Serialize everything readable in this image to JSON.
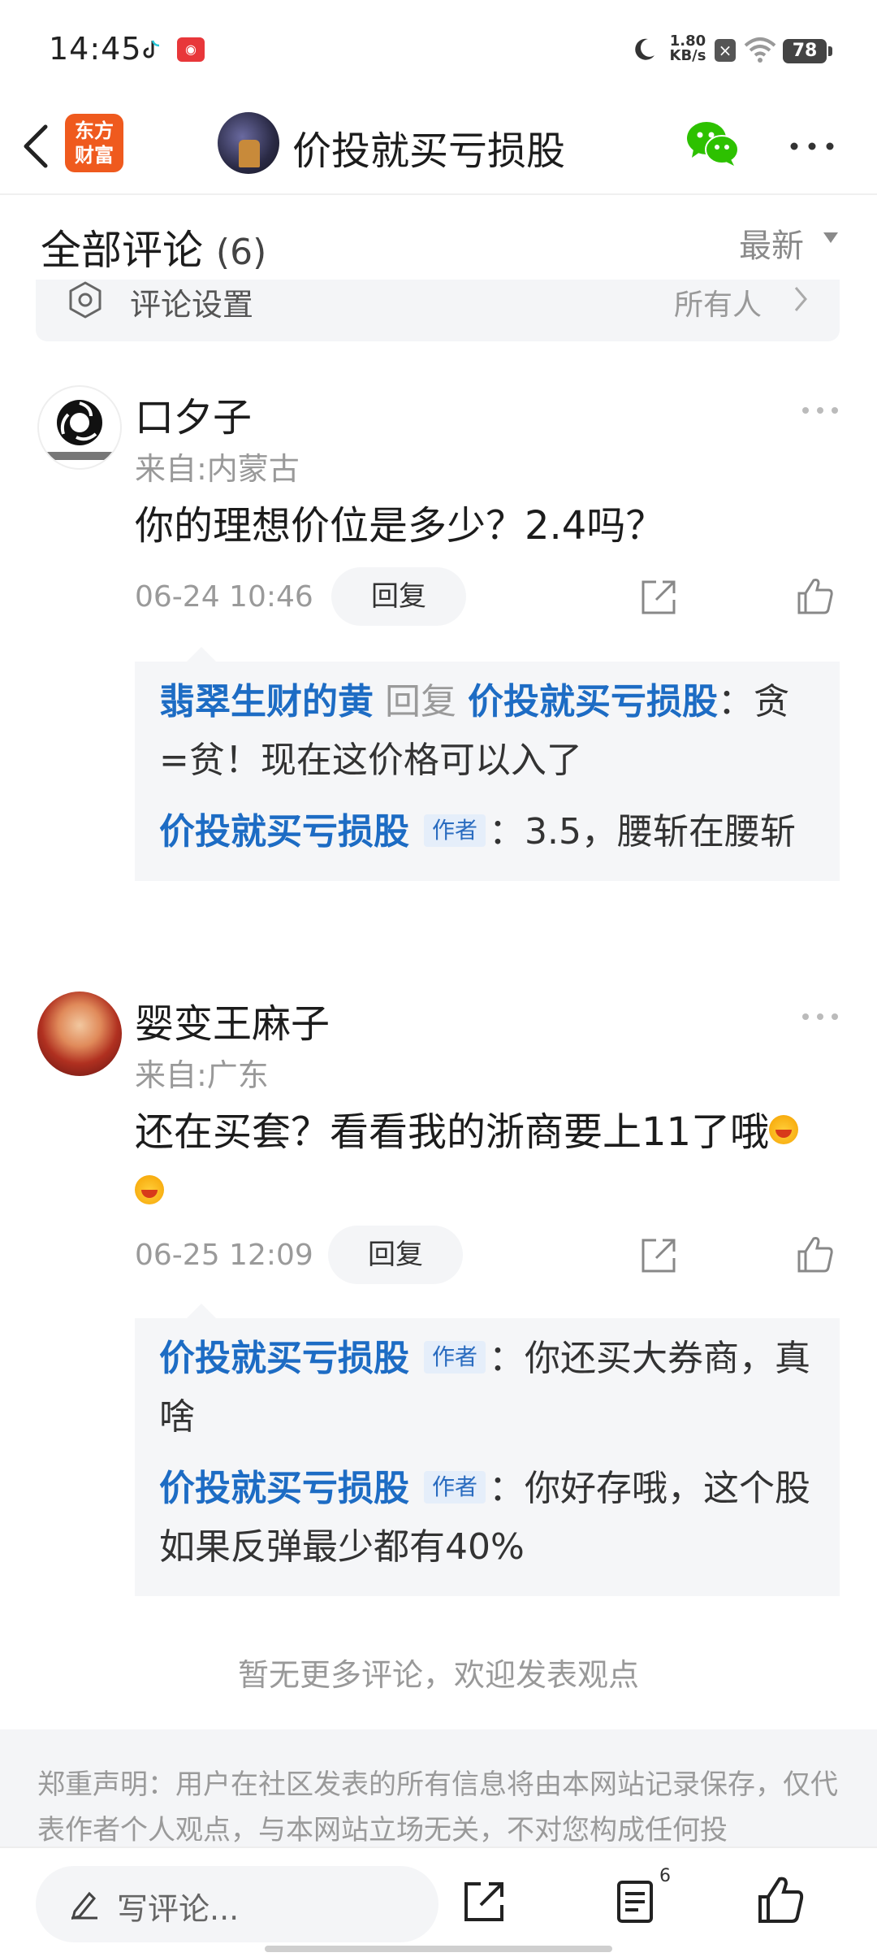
{
  "status_bar": {
    "time": "14:45",
    "net_speed_value": "1.80",
    "net_speed_unit": "KB/s",
    "battery": "78",
    "icons": [
      "tiktok-icon",
      "app-notification-icon",
      "moon-icon",
      "no-sim-icon",
      "wifi-icon",
      "battery-icon"
    ]
  },
  "header": {
    "logo_line1": "东方",
    "logo_line2": "财富",
    "title": "价投就买亏损股"
  },
  "comments_section": {
    "title": "全部评论",
    "count": "(6)",
    "sort": "最新",
    "settings_label": "评论设置",
    "settings_value": "所有人"
  },
  "comments": [
    {
      "username": "口夕子",
      "location": "来自:内蒙古",
      "text": "你的理想价位是多少？2.4吗？",
      "time": "06-24 10:46",
      "reply_label": "回复",
      "replies": [
        {
          "name": "翡翠生财的黄",
          "verb": "回复",
          "target": "价投就买亏损股",
          "text": "：贪=贫！现在这价格可以入了"
        },
        {
          "name": "价投就买亏损股",
          "tag": "作者",
          "text": "：3.5，腰斩在腰斩"
        }
      ]
    },
    {
      "username": "婴变王麻子",
      "location": "来自:广东",
      "text": "还在买套？看看我的浙商要上11了哦",
      "time": "06-25 12:09",
      "reply_label": "回复",
      "replies": [
        {
          "name": "价投就买亏损股",
          "tag": "作者",
          "text": "：你还买大券商，真啥"
        },
        {
          "name": "价投就买亏损股",
          "tag": "作者",
          "text": "：你好存哦，这个股如果反弹最少都有40%"
        }
      ]
    }
  ],
  "no_more": "暂无更多评论，欢迎发表观点",
  "disclaimer": "郑重声明：用户在社区发表的所有信息将由本网站记录保存，仅代表作者个人观点，与本网站立场无关，不对您构成任何投",
  "bottom_bar": {
    "write_placeholder": "写评论...",
    "comment_count": "6"
  },
  "colors": {
    "brand_orange": "#ef5a1e",
    "link_blue": "#1d6cc4",
    "wechat_green": "#2dc100"
  }
}
